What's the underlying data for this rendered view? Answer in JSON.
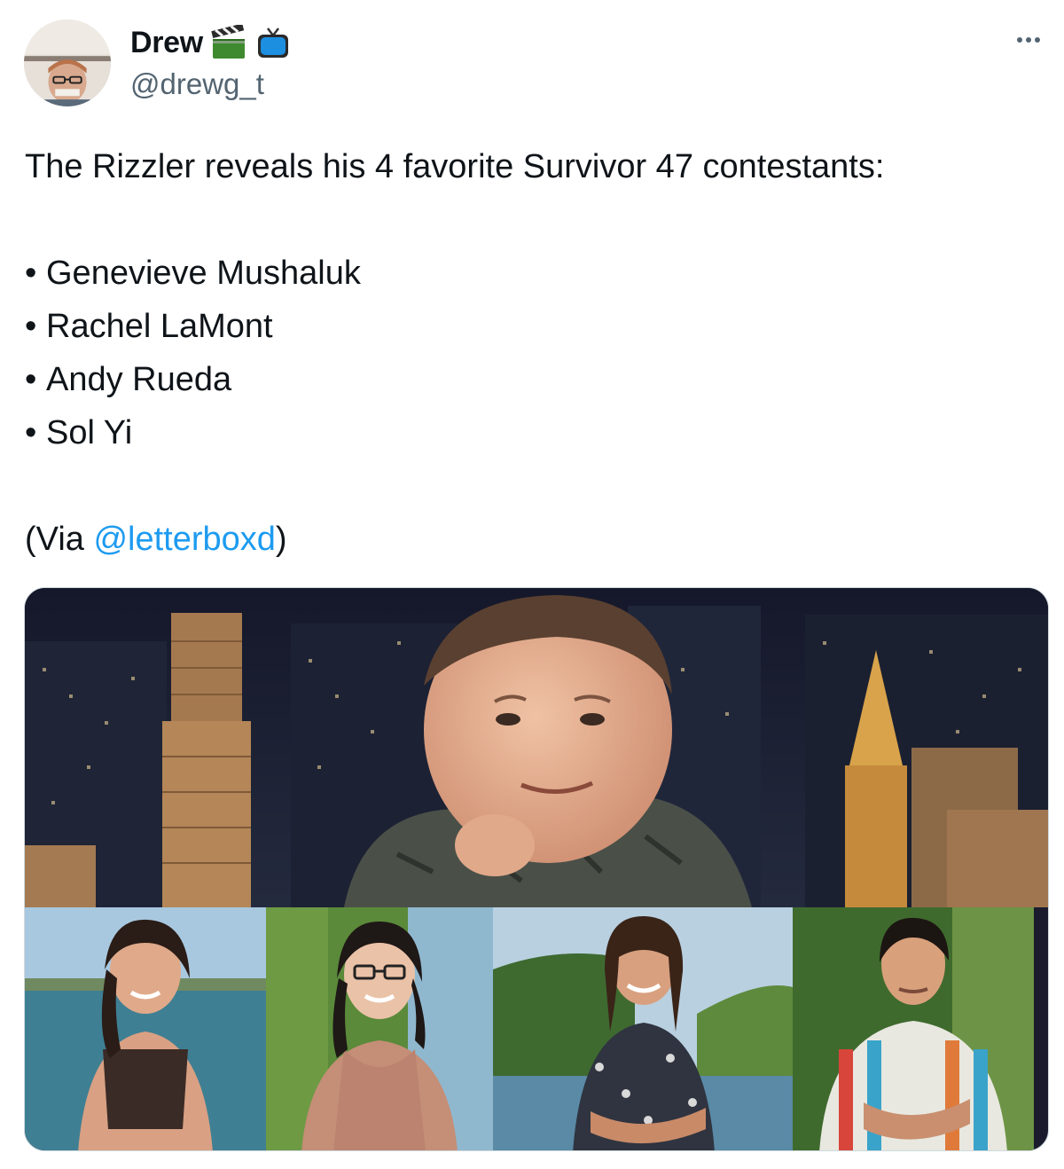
{
  "author": {
    "display_name": "Drew",
    "handle": "@drewg_t",
    "emoji_icons": [
      "clapper-board-icon",
      "television-icon"
    ]
  },
  "tweet": {
    "intro": "The Rizzler reveals his 4 favorite Survivor 47 contestants:",
    "bullet_char": "•",
    "list": [
      "Genevieve Mushaluk",
      "Rachel LaMont",
      "Andy Rueda",
      "Sol Yi"
    ],
    "via_prefix": "(Via ",
    "via_mention": "@letterboxd",
    "via_suffix": ")"
  },
  "colors": {
    "text": "#0f1419",
    "secondary": "#536471",
    "link": "#1d9bf0"
  }
}
